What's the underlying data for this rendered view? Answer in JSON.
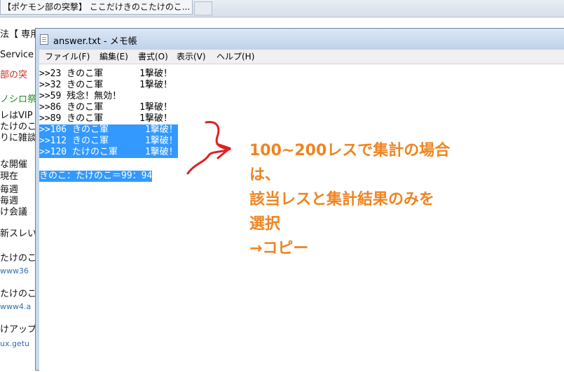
{
  "browser": {
    "tab_title": "【ポケモン部の突撃】 ここだけきのこたけのこ...",
    "page_lines": [
      {
        "text": "法【 専用",
        "color": "#111111"
      },
      {
        "text": "Service",
        "color": "#111111"
      },
      {
        "text": "部の突",
        "color": "#d22a1e"
      },
      {
        "text": "ノシロ祭",
        "color": "#1e8a1e"
      },
      {
        "text": "レはVIP",
        "color": "#111111"
      },
      {
        "text": "たけのこ",
        "color": "#111111"
      },
      {
        "text": "りに雑談",
        "color": "#111111"
      },
      {
        "text": "な開催",
        "color": "#111111"
      },
      {
        "text": "現在",
        "color": "#111111"
      },
      {
        "text": "毎週",
        "color": "#111111"
      },
      {
        "text": "毎週",
        "color": "#111111"
      },
      {
        "text": "け会議",
        "color": "#111111"
      },
      {
        "text": "新スレい",
        "color": "#111111"
      },
      {
        "text": "たけのこ",
        "color": "#111111"
      },
      {
        "text": "www36",
        "color": "#2e6fb6"
      },
      {
        "text": "たけのこ",
        "color": "#111111"
      },
      {
        "text": "www4.a",
        "color": "#2e6fb6"
      },
      {
        "text": "けアップ",
        "color": "#111111"
      },
      {
        "text": "ux.getu",
        "color": "#2e6fb6"
      }
    ]
  },
  "notepad": {
    "title": "answer.txt - メモ帳",
    "menu": [
      "ファイル(F)",
      "編集(E)",
      "書式(O)",
      "表示(V)",
      "ヘルプ(H)"
    ],
    "lines": [
      {
        "text": ">>23 きのこ軍　　　　1撃破！",
        "selected": false
      },
      {
        "text": ">>32 きのこ軍　　　　1撃破！",
        "selected": false
      },
      {
        "text": ">>59 残念！無効！",
        "selected": false
      },
      {
        "text": ">>86 きのこ軍　　　　1撃破！",
        "selected": false
      },
      {
        "text": ">>89 きのこ軍　　　　1撃破！",
        "selected": false
      },
      {
        "text": ">>106 きのこ軍　　　　1撃破！",
        "selected": true
      },
      {
        "text": ">>112 きのこ軍　　　　1撃破！",
        "selected": true
      },
      {
        "text": ">>120 たけのこ軍　　　1撃破！",
        "selected": true
      },
      {
        "text": "",
        "selected": false
      },
      {
        "text": "きのこ：たけのこ＝99：94",
        "selected": true
      }
    ]
  },
  "annotation": {
    "color": "#ef8420",
    "lines": [
      "100~200レスで集計の場合",
      "は、",
      "該当レスと集計結果のみを",
      "選択",
      "→コピー"
    ]
  },
  "colors": {
    "selection": "#3399ff",
    "arrow": "#e02020"
  }
}
